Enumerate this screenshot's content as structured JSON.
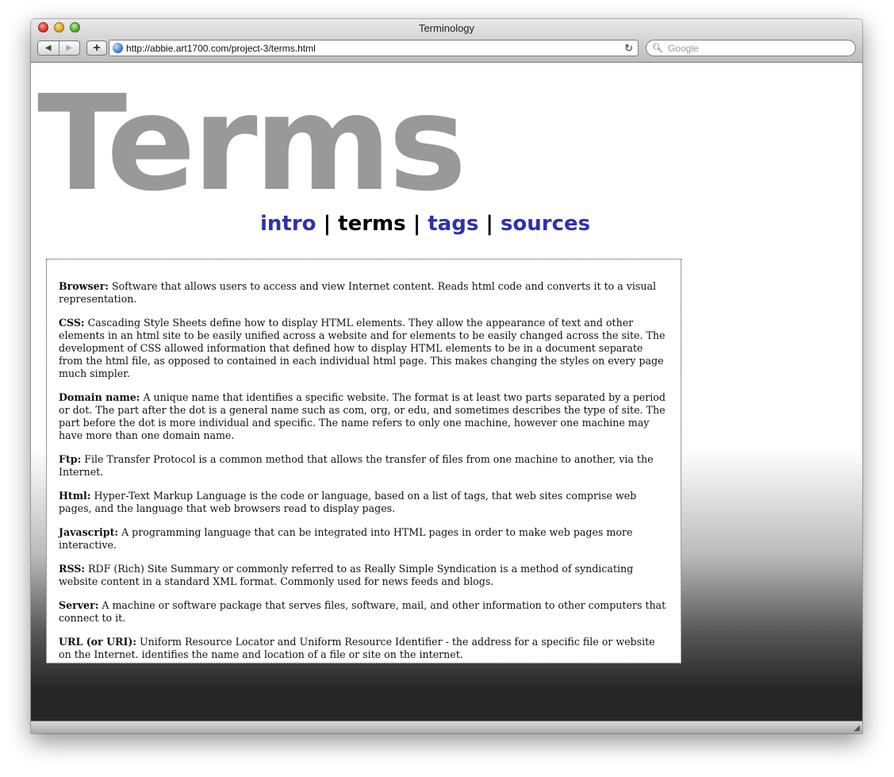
{
  "window": {
    "title": "Terminology"
  },
  "toolbar": {
    "back_icon": "back-arrow-icon",
    "forward_icon": "forward-arrow-icon",
    "add_label": "+",
    "url": "http://abbie.art1700.com/project-3/terms.html",
    "search_placeholder": "Google"
  },
  "page": {
    "heading": "Terms",
    "nav": [
      {
        "label": "intro",
        "current": false
      },
      {
        "label": "terms",
        "current": true
      },
      {
        "label": "tags",
        "current": false
      },
      {
        "label": "sources",
        "current": false
      }
    ],
    "nav_separator": "|",
    "terms": [
      {
        "term": "Browser:",
        "definition": "Software that allows users to access and view Internet content. Reads html code and converts it to a visual representation."
      },
      {
        "term": "CSS:",
        "definition": "Cascading Style Sheets define how to display HTML elements. They allow the appearance of text and other elements in an html site to be easily unified across a website and for elements to be easily changed across the site. The development of CSS allowed information that defined how to display HTML elements to be in a document separate from the html file, as opposed to contained in each individual html page. This makes changing the styles on every page much simpler."
      },
      {
        "term": "Domain name:",
        "definition": "A unique name that identifies a specific website. The format is at least two parts separated by a period or dot. The part after the dot is a general name such as com, org, or edu, and sometimes describes the type of site. The part before the dot is more individual and specific. The name refers to only one machine, however one machine may have more than one domain name."
      },
      {
        "term": "Ftp:",
        "definition": "File Transfer Protocol is a common method that allows the transfer of files from one machine to another, via the Internet."
      },
      {
        "term": "Html:",
        "definition": "Hyper-Text Markup Language is the code or language, based on a list of tags, that web sites comprise web pages, and the language that web browsers read to display pages."
      },
      {
        "term": "Javascript:",
        "definition": "A programming language that can be integrated into HTML pages in order to make web pages more interactive."
      },
      {
        "term": "RSS:",
        "definition": "RDF (Rich) Site Summary or commonly referred to as Really Simple Syndication is a method of syndicating website content in a standard XML format. Commonly used for news feeds and blogs."
      },
      {
        "term": "Server:",
        "definition": "A machine or software package that serves files, software, mail, and other information to other computers that connect to it."
      },
      {
        "term": "URL (or URI):",
        "definition": "Uniform Resource Locator and Uniform Resource Identifier - the address for a specific file or website on the Internet. identifies the name and location of a file or site on the internet."
      }
    ]
  },
  "colors": {
    "heading": "#999999",
    "link": "#3030b0",
    "current_link": "#000000"
  }
}
